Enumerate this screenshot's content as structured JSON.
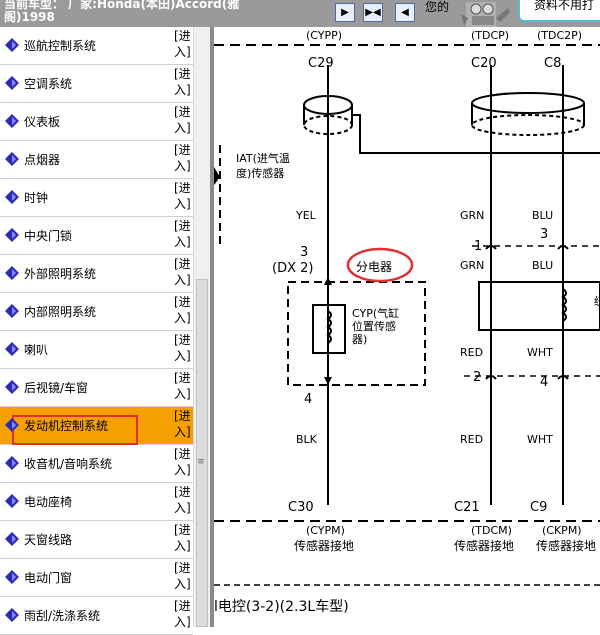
{
  "header": {
    "car_label": "当前车型： 厂家:Honda(本田)Accord(雅阁)1998",
    "your_text": "您的",
    "ad_text": "资料不用打",
    "nav_buttons": [
      "▶",
      "▶◀",
      "◀"
    ]
  },
  "sidebar": {
    "enter_label": "[进入]",
    "items": [
      {
        "label": "巡航控制系统"
      },
      {
        "label": "空调系统"
      },
      {
        "label": "仪表板"
      },
      {
        "label": "点烟器"
      },
      {
        "label": "时钟"
      },
      {
        "label": "中央门锁"
      },
      {
        "label": "外部照明系统"
      },
      {
        "label": "内部照明系统"
      },
      {
        "label": "喇叭"
      },
      {
        "label": "后视镜/车窗"
      },
      {
        "label": "发动机控制系统",
        "active": true
      },
      {
        "label": "收音机/音响系统"
      },
      {
        "label": "电动座椅"
      },
      {
        "label": "天窗线路"
      },
      {
        "label": "电动门窗"
      },
      {
        "label": "雨刮/洗涤系统"
      }
    ]
  },
  "diagram": {
    "top_labels": [
      "(CYPP)",
      "(TDCP)",
      "(TDC2P)"
    ],
    "pin_top": [
      "C29",
      "C20",
      "C8"
    ],
    "iat_label": [
      "IAT(进气温",
      "度)传感器"
    ],
    "wire_colors_upper": [
      "YEL",
      "GRN",
      "BLU"
    ],
    "connector_pins": [
      "3",
      "1",
      "3"
    ],
    "dx2_label": "(DX 2)",
    "distributor_label": "分电器",
    "wire_colors_mid": [
      "GRN",
      "BLU"
    ],
    "cyp_label": [
      "CYP(气缸",
      "位置传感",
      "器)"
    ],
    "lower_pins": [
      "4",
      "2",
      "4"
    ],
    "wire_colors_lower1": [
      "RED",
      "WHT"
    ],
    "wire_colors_lower2": [
      "BLK",
      "RED",
      "WHT"
    ],
    "pin_bottom": [
      "C30",
      "C21",
      "C9"
    ],
    "bottom_labels": [
      "(CYPM)",
      "(TDCM)",
      "(CKPM)"
    ],
    "ground_labels": [
      "传感器接地",
      "传感器接地",
      "传感器接地"
    ],
    "caption": "l电控(3-2)(2.3L车型)",
    "right_edge_char": "统"
  }
}
